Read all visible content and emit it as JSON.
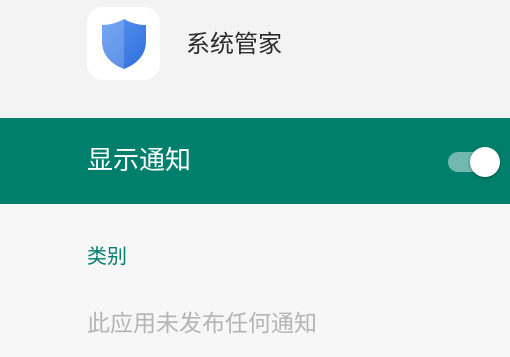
{
  "app": {
    "name": "系统管家",
    "icon": "shield-icon",
    "icon_color": "#3b7be0"
  },
  "notifications": {
    "label": "显示通知",
    "enabled": true,
    "bar_color": "#007f6d"
  },
  "categories": {
    "heading": "类别",
    "empty_message": "此应用未发布任何通知"
  }
}
